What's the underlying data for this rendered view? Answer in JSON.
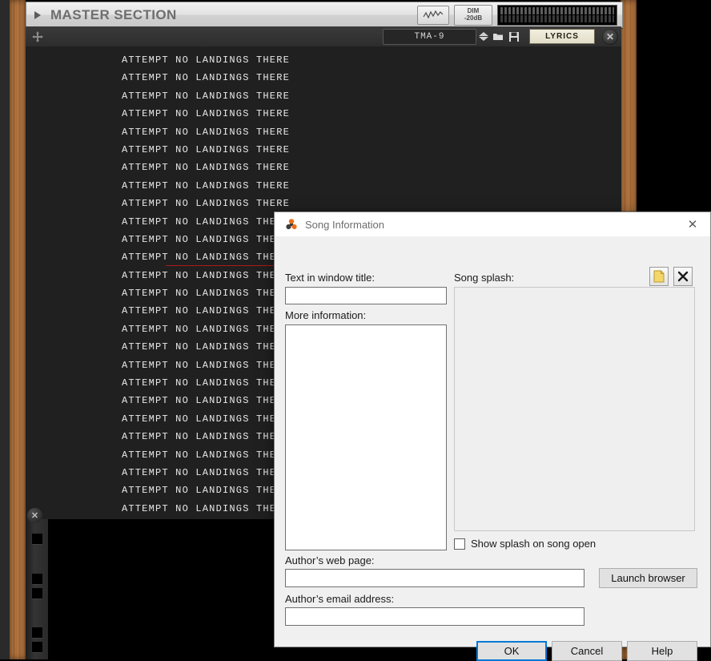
{
  "app": {
    "master_section": {
      "title": "MASTER SECTION",
      "disclosure_icon": "triangle-right-icon",
      "waveform_button_icon": "waveform-icon",
      "dim_button": {
        "line1": "DIM",
        "line2": "-20dB"
      },
      "meter_icon": "level-meter"
    },
    "toolbar": {
      "move_handle_icon": "move-handle-icon",
      "song_name": "TMA-9",
      "spinner_icon": "spinner-up-down-icon",
      "folder_icon": "folder-icon",
      "save_icon": "floppy-save-icon",
      "lyrics_tab_label": "LYRICS",
      "close_icon": "close-circle-icon"
    },
    "lyrics": {
      "line_text": "ATTEMPT NO LANDINGS THERE",
      "line_count": 26,
      "play_cursor_after_line": 12,
      "cursor_color": "#b01818",
      "text_color": "#e8e8e8",
      "background": "#202020"
    },
    "rack": {
      "close_icon": "close-circle-icon",
      "wood_color": "#a86c38"
    }
  },
  "dialog": {
    "title": "Song Information",
    "app_icon": "reaper-trefoil-icon",
    "close_icon": "close-icon",
    "fields": {
      "window_title": {
        "label": "Text in window title:",
        "value": ""
      },
      "more_information": {
        "label": "More information:",
        "value": ""
      },
      "song_splash": {
        "label": "Song splash:"
      },
      "web_page": {
        "label": "Author’s web page:",
        "value": ""
      },
      "email": {
        "label": "Author’s email address:",
        "value": ""
      }
    },
    "splash_buttons": {
      "load_icon": "file-yellow-icon",
      "clear_icon": "x-clear-icon"
    },
    "checkbox": {
      "label": "Show splash on song open",
      "checked": false
    },
    "buttons": {
      "launch_browser": "Launch browser",
      "ok": "OK",
      "cancel": "Cancel",
      "help": "Help"
    },
    "accent_color": "#0078d7"
  }
}
